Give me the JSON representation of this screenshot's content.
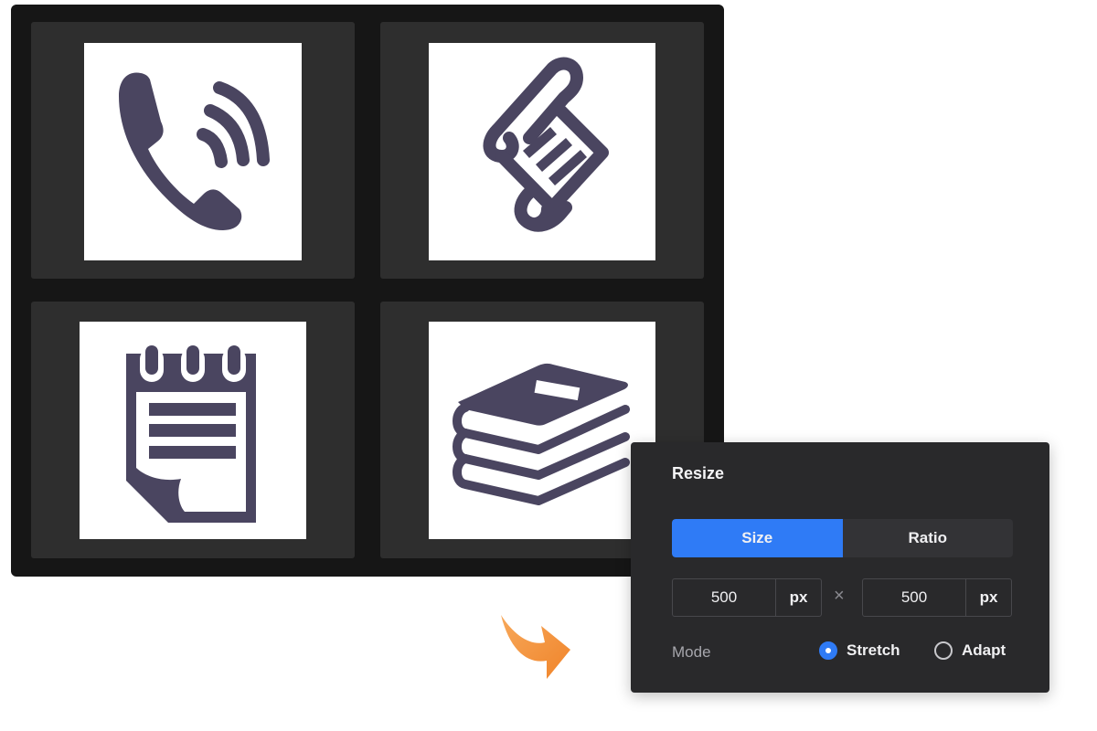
{
  "canvas": {
    "tiles": [
      {
        "icon": "phone-ringing-icon"
      },
      {
        "icon": "scroll-document-icon"
      },
      {
        "icon": "notepad-icon"
      },
      {
        "icon": "books-stack-icon"
      }
    ],
    "icon_color": "#4a4560"
  },
  "arrow": {
    "icon": "curved-arrow-icon",
    "color": "#f28c2e"
  },
  "dialog": {
    "title": "Resize",
    "tabs": [
      {
        "label": "Size",
        "active": true
      },
      {
        "label": "Ratio",
        "active": false
      }
    ],
    "width": {
      "value": "500",
      "unit": "px"
    },
    "separator": "×",
    "height": {
      "value": "500",
      "unit": "px"
    },
    "mode": {
      "label": "Mode",
      "options": [
        {
          "label": "Stretch",
          "selected": true
        },
        {
          "label": "Adapt",
          "selected": false
        }
      ]
    },
    "accent_color": "#2f7bf6"
  }
}
